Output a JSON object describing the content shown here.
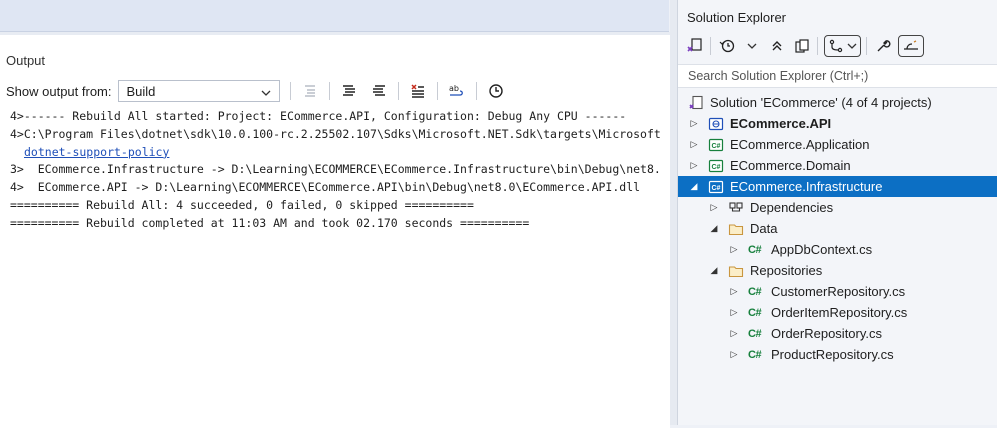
{
  "output": {
    "title": "Output",
    "show_from_label": "Show output from:",
    "source_value": "Build",
    "lines": [
      "4>------ Rebuild All started: Project: ECommerce.API, Configuration: Debug Any CPU ------",
      "4>C:\\Program Files\\dotnet\\sdk\\10.0.100-rc.2.25502.107\\Sdks\\Microsoft.NET.Sdk\\targets\\Microsoft",
      "3>  ECommerce.Infrastructure -> D:\\Learning\\ECOMMERCE\\ECommerce.Infrastructure\\bin\\Debug\\net8.",
      "4>  ECommerce.API -> D:\\Learning\\ECOMMERCE\\ECommerce.API\\bin\\Debug\\net8.0\\ECommerce.API.dll",
      "========== Rebuild All: 4 succeeded, 0 failed, 0 skipped ==========",
      "========== Rebuild completed at 11:03 AM and took 02.170 seconds =========="
    ],
    "link_text": "dotnet-support-policy"
  },
  "solution_explorer": {
    "title": "Solution Explorer",
    "search_placeholder": "Search Solution Explorer (Ctrl+;)",
    "tree": [
      {
        "label": "Solution 'ECommerce' (4 of 4 projects)",
        "icon": "solution-icon"
      },
      {
        "label": "ECommerce.API",
        "icon": "web-project-icon",
        "bold": true,
        "expanded": false
      },
      {
        "label": "ECommerce.Application",
        "icon": "csharp-project-icon",
        "expanded": false
      },
      {
        "label": "ECommerce.Domain",
        "icon": "csharp-project-icon",
        "expanded": false
      },
      {
        "label": "ECommerce.Infrastructure",
        "icon": "csharp-project-icon",
        "expanded": true,
        "selected": true
      },
      {
        "label": "Dependencies",
        "icon": "dependencies-icon",
        "expanded": false
      },
      {
        "label": "Data",
        "icon": "folder-icon",
        "expanded": true
      },
      {
        "label": "AppDbContext.cs",
        "icon": "csharp-file-icon",
        "glyph": "C#"
      },
      {
        "label": "Repositories",
        "icon": "folder-icon",
        "expanded": true
      },
      {
        "label": "CustomerRepository.cs",
        "icon": "csharp-file-icon",
        "glyph": "C#"
      },
      {
        "label": "OrderItemRepository.cs",
        "icon": "csharp-file-icon",
        "glyph": "C#"
      },
      {
        "label": "OrderRepository.cs",
        "icon": "csharp-file-icon",
        "glyph": "C#"
      },
      {
        "label": "ProductRepository.cs",
        "icon": "csharp-file-icon",
        "glyph": "C#"
      }
    ]
  },
  "colors": {
    "selection": "#0c6fc4",
    "link": "#1f4fb8",
    "csharp_green": "#17803d",
    "folder_yellow": "#dcb67a"
  }
}
